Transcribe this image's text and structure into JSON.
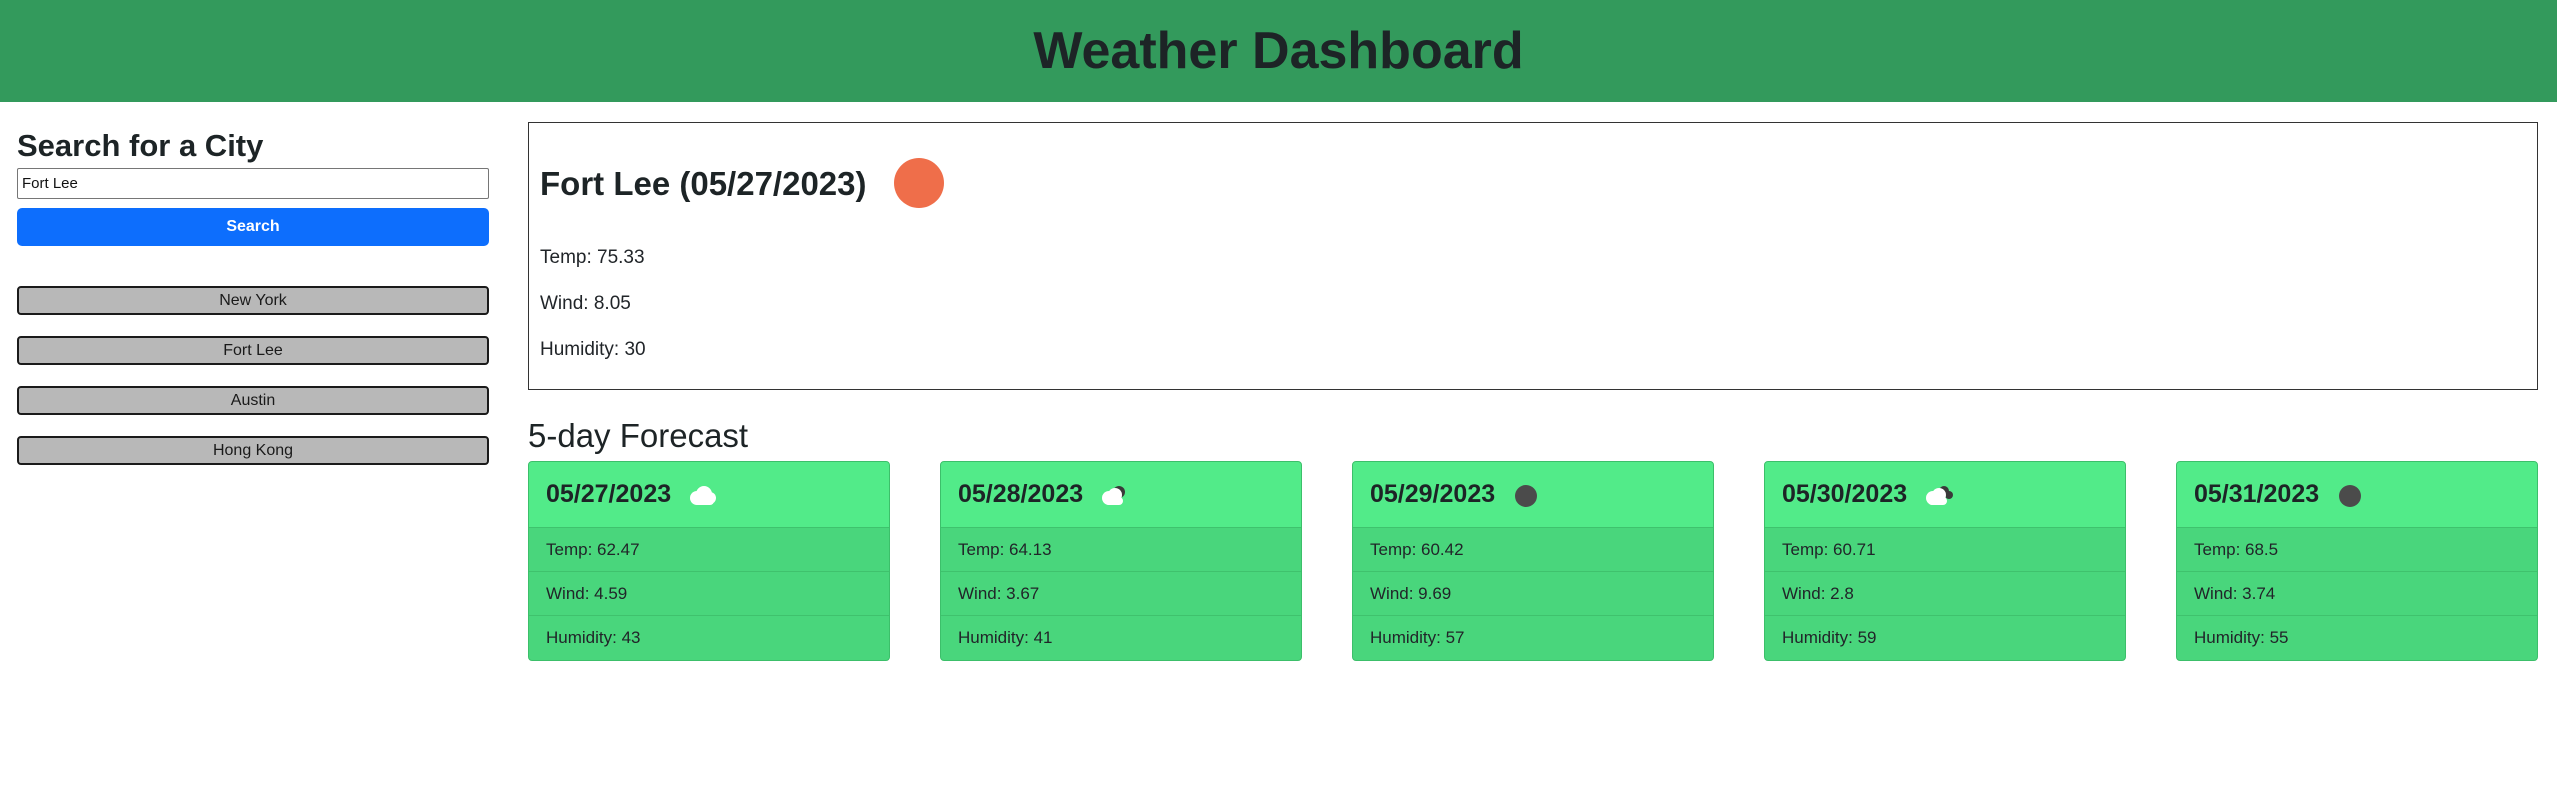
{
  "header": {
    "title": "Weather Dashboard"
  },
  "sidebar": {
    "heading": "Search for a City",
    "search_value": "Fort Lee",
    "search_button": "Search",
    "history": [
      {
        "label": "New York"
      },
      {
        "label": "Fort Lee"
      },
      {
        "label": "Austin"
      },
      {
        "label": "Hong Kong"
      }
    ]
  },
  "current": {
    "title": "Fort Lee (05/27/2023)",
    "icon": "sun-icon",
    "icon_color": "#ef6e4a",
    "temp": "Temp: 75.33",
    "wind": "Wind: 8.05",
    "humidity": "Humidity: 30"
  },
  "forecast": {
    "heading": "5-day Forecast",
    "days": [
      {
        "date": "05/27/2023",
        "icon": "cloud-icon",
        "temp": "Temp: 62.47",
        "wind": "Wind: 4.59",
        "humidity": "Humidity: 43"
      },
      {
        "date": "05/28/2023",
        "icon": "cloud-with-dark-cloud-icon",
        "temp": "Temp: 64.13",
        "wind": "Wind: 3.67",
        "humidity": "Humidity: 41"
      },
      {
        "date": "05/29/2023",
        "icon": "dark-circle-icon",
        "temp": "Temp: 60.42",
        "wind": "Wind: 9.69",
        "humidity": "Humidity: 57"
      },
      {
        "date": "05/30/2023",
        "icon": "broken-clouds-icon",
        "temp": "Temp: 60.71",
        "wind": "Wind: 2.8",
        "humidity": "Humidity: 59"
      },
      {
        "date": "05/31/2023",
        "icon": "dark-circle-icon",
        "temp": "Temp: 68.5",
        "wind": "Wind: 3.74",
        "humidity": "Humidity: 55"
      }
    ]
  },
  "colors": {
    "header_bg": "#339a5c",
    "primary_button": "#0d6efd",
    "history_button": "#b8b8b8",
    "card_bg": "#49d67c",
    "card_header_bg": "#52eb89"
  }
}
